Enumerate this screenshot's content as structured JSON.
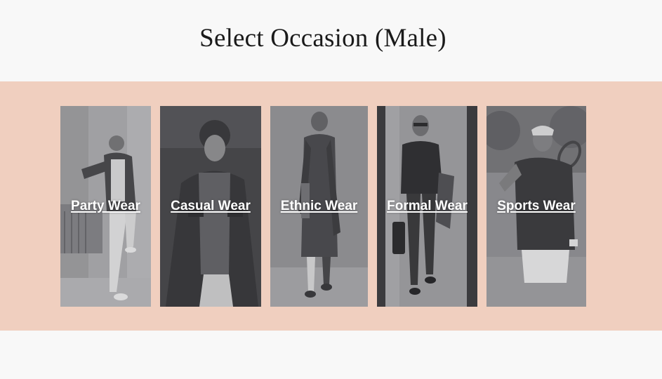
{
  "page": {
    "title": "Select Occasion (Male)"
  },
  "colors": {
    "background": "#f8f8f8",
    "band": "#f0cfbf",
    "label": "#ffffff",
    "title": "#1a1a1a"
  },
  "occasions": [
    {
      "label": "Party Wear",
      "icon": "man-leaning-on-wall-photo"
    },
    {
      "label": "Casual Wear",
      "icon": "man-in-leather-jacket-photo"
    },
    {
      "label": "Ethnic Wear",
      "icon": "man-in-kurta-photo"
    },
    {
      "label": "Formal Wear",
      "icon": "man-in-turtleneck-photo"
    },
    {
      "label": "Sports Wear",
      "icon": "man-with-tennis-racket-photo"
    }
  ]
}
